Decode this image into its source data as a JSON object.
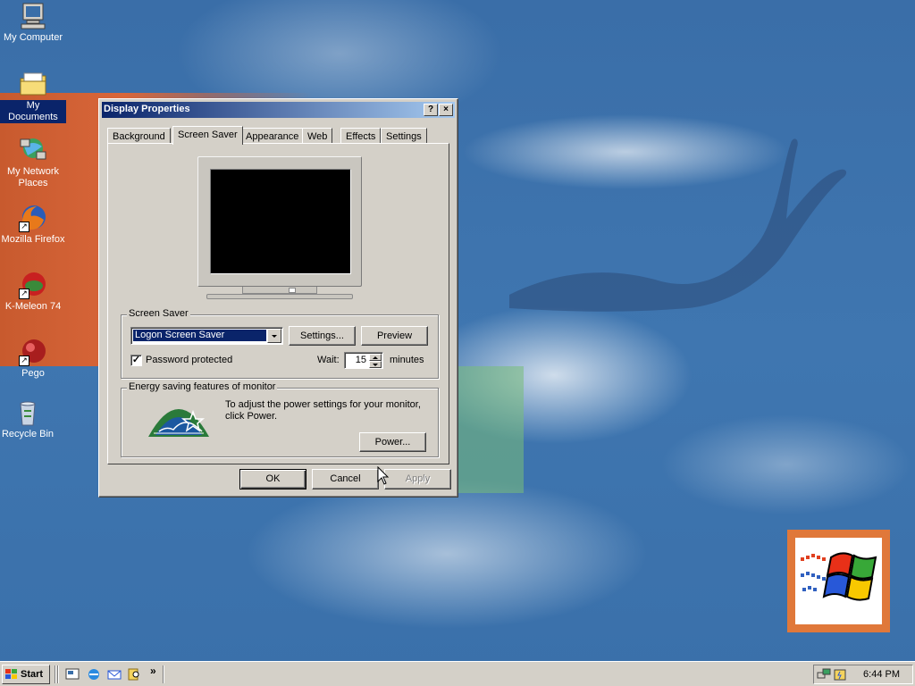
{
  "desktop": {
    "icons": [
      {
        "label": "My Computer",
        "icon": "computer-icon"
      },
      {
        "label": "My Documents",
        "icon": "folder-icon"
      },
      {
        "label": "My Network Places",
        "icon": "network-icon"
      },
      {
        "label": "Mozilla Firefox",
        "icon": "firefox-icon"
      },
      {
        "label": "K-Meleon 74",
        "icon": "k-meleon-icon"
      },
      {
        "label": "Pego",
        "icon": "pego-icon"
      },
      {
        "label": "Recycle Bin",
        "icon": "recycle-bin-icon"
      }
    ]
  },
  "dialog": {
    "title": "Display Properties",
    "help_btn": "?",
    "close_btn": "×",
    "tabs": [
      {
        "label": "Background",
        "active": false
      },
      {
        "label": "Screen Saver",
        "active": true
      },
      {
        "label": "Appearance",
        "active": false
      },
      {
        "label": "Web",
        "active": false
      },
      {
        "label": "Effects",
        "active": false
      },
      {
        "label": "Settings",
        "active": false
      }
    ],
    "screensaver": {
      "group_title": "Screen Saver",
      "selected": "Logon Screen Saver",
      "settings_btn": "Settings...",
      "preview_btn": "Preview",
      "password_label": "Password protected",
      "password_checked": true,
      "check_mark": "✓",
      "wait_label": "Wait:",
      "wait_value": "15",
      "wait_unit": "minutes"
    },
    "energy": {
      "group_title": "Energy saving features of monitor",
      "logo_text": "energy",
      "description": "To adjust the power settings for your monitor, click Power.",
      "power_btn": "Power..."
    },
    "buttons": {
      "ok": "OK",
      "cancel": "Cancel",
      "apply": "Apply"
    }
  },
  "taskbar": {
    "start_label": "Start",
    "chevron": "»",
    "clock": "6:44 PM"
  }
}
